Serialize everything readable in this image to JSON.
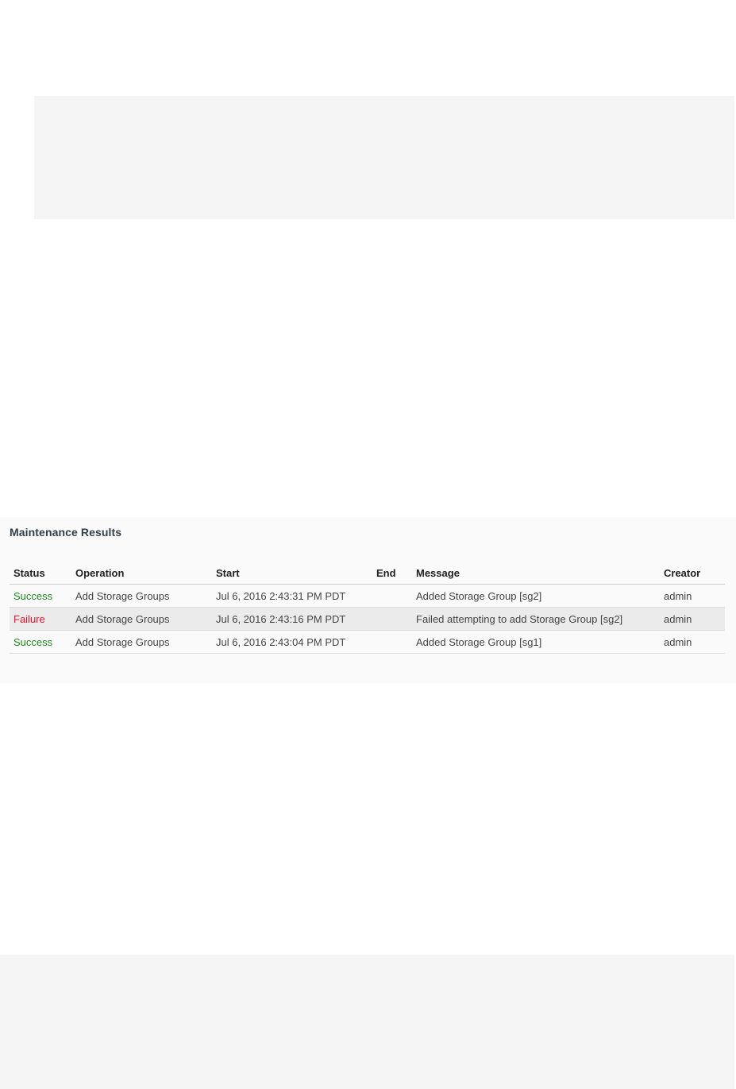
{
  "panel": {
    "title": "Maintenance Results"
  },
  "table": {
    "headers": {
      "status": "Status",
      "operation": "Operation",
      "start": "Start",
      "end": "End",
      "message": "Message",
      "creator": "Creator"
    },
    "rows": [
      {
        "status": "Success",
        "operation": "Add Storage Groups",
        "start": "Jul 6, 2016 2:43:31 PM PDT",
        "end": "",
        "message": "Added Storage Group [sg2]",
        "creator": "admin"
      },
      {
        "status": "Failure",
        "operation": "Add Storage Groups",
        "start": "Jul 6, 2016 2:43:16 PM PDT",
        "end": "",
        "message": "Failed attempting to add Storage Group [sg2]",
        "creator": "admin"
      },
      {
        "status": "Success",
        "operation": "Add Storage Groups",
        "start": "Jul 6, 2016 2:43:04 PM PDT",
        "end": "",
        "message": "Added Storage Group [sg1]",
        "creator": "admin"
      }
    ]
  },
  "colors": {
    "success": "#1e8a1e",
    "failure": "#e8112d",
    "panel_background": "#fafafa",
    "block_background": "#f5f5f5"
  }
}
